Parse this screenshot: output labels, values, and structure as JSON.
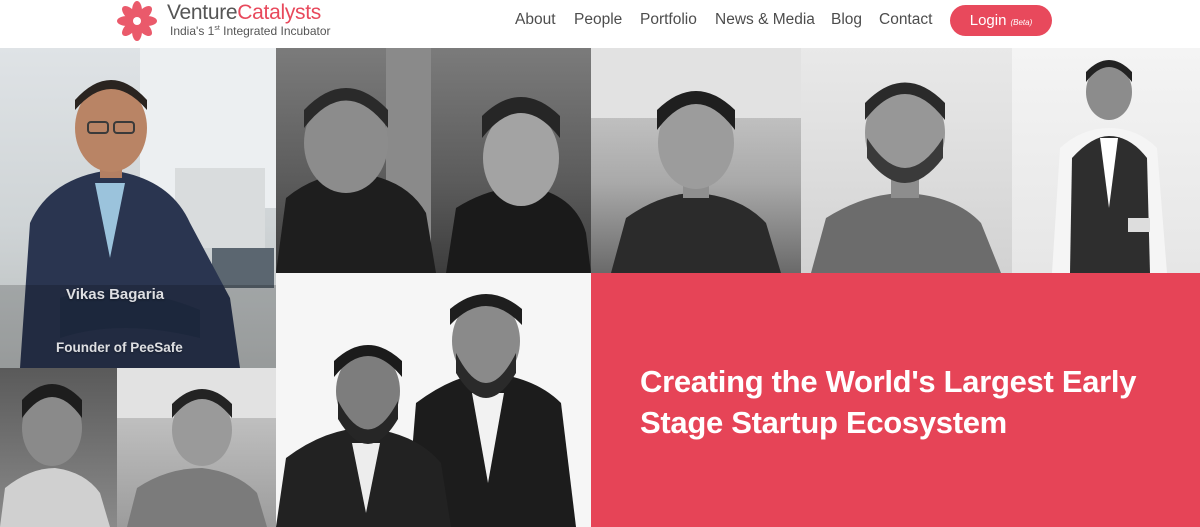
{
  "brand": {
    "name_part1": "Venture",
    "name_part2": "Catalysts",
    "tagline_pre": "India's 1",
    "tagline_sup": "st",
    "tagline_post": " Integrated Incubator",
    "accent_color": "#e8495c"
  },
  "nav": {
    "about": "About",
    "people": "People",
    "portfolio": "Portfolio",
    "news": "News & Media",
    "blog": "Blog",
    "contact": "Contact"
  },
  "login": {
    "label": "Login",
    "badge": "(Beta)"
  },
  "featured": {
    "name": "Vikas Bagaria",
    "role": "Founder of PeeSafe"
  },
  "hero": {
    "headline": "Creating the World's Largest Early Stage Startup Ecosystem",
    "background_color": "#e64457"
  },
  "icons": {
    "logo": "lotus-logo-icon"
  }
}
